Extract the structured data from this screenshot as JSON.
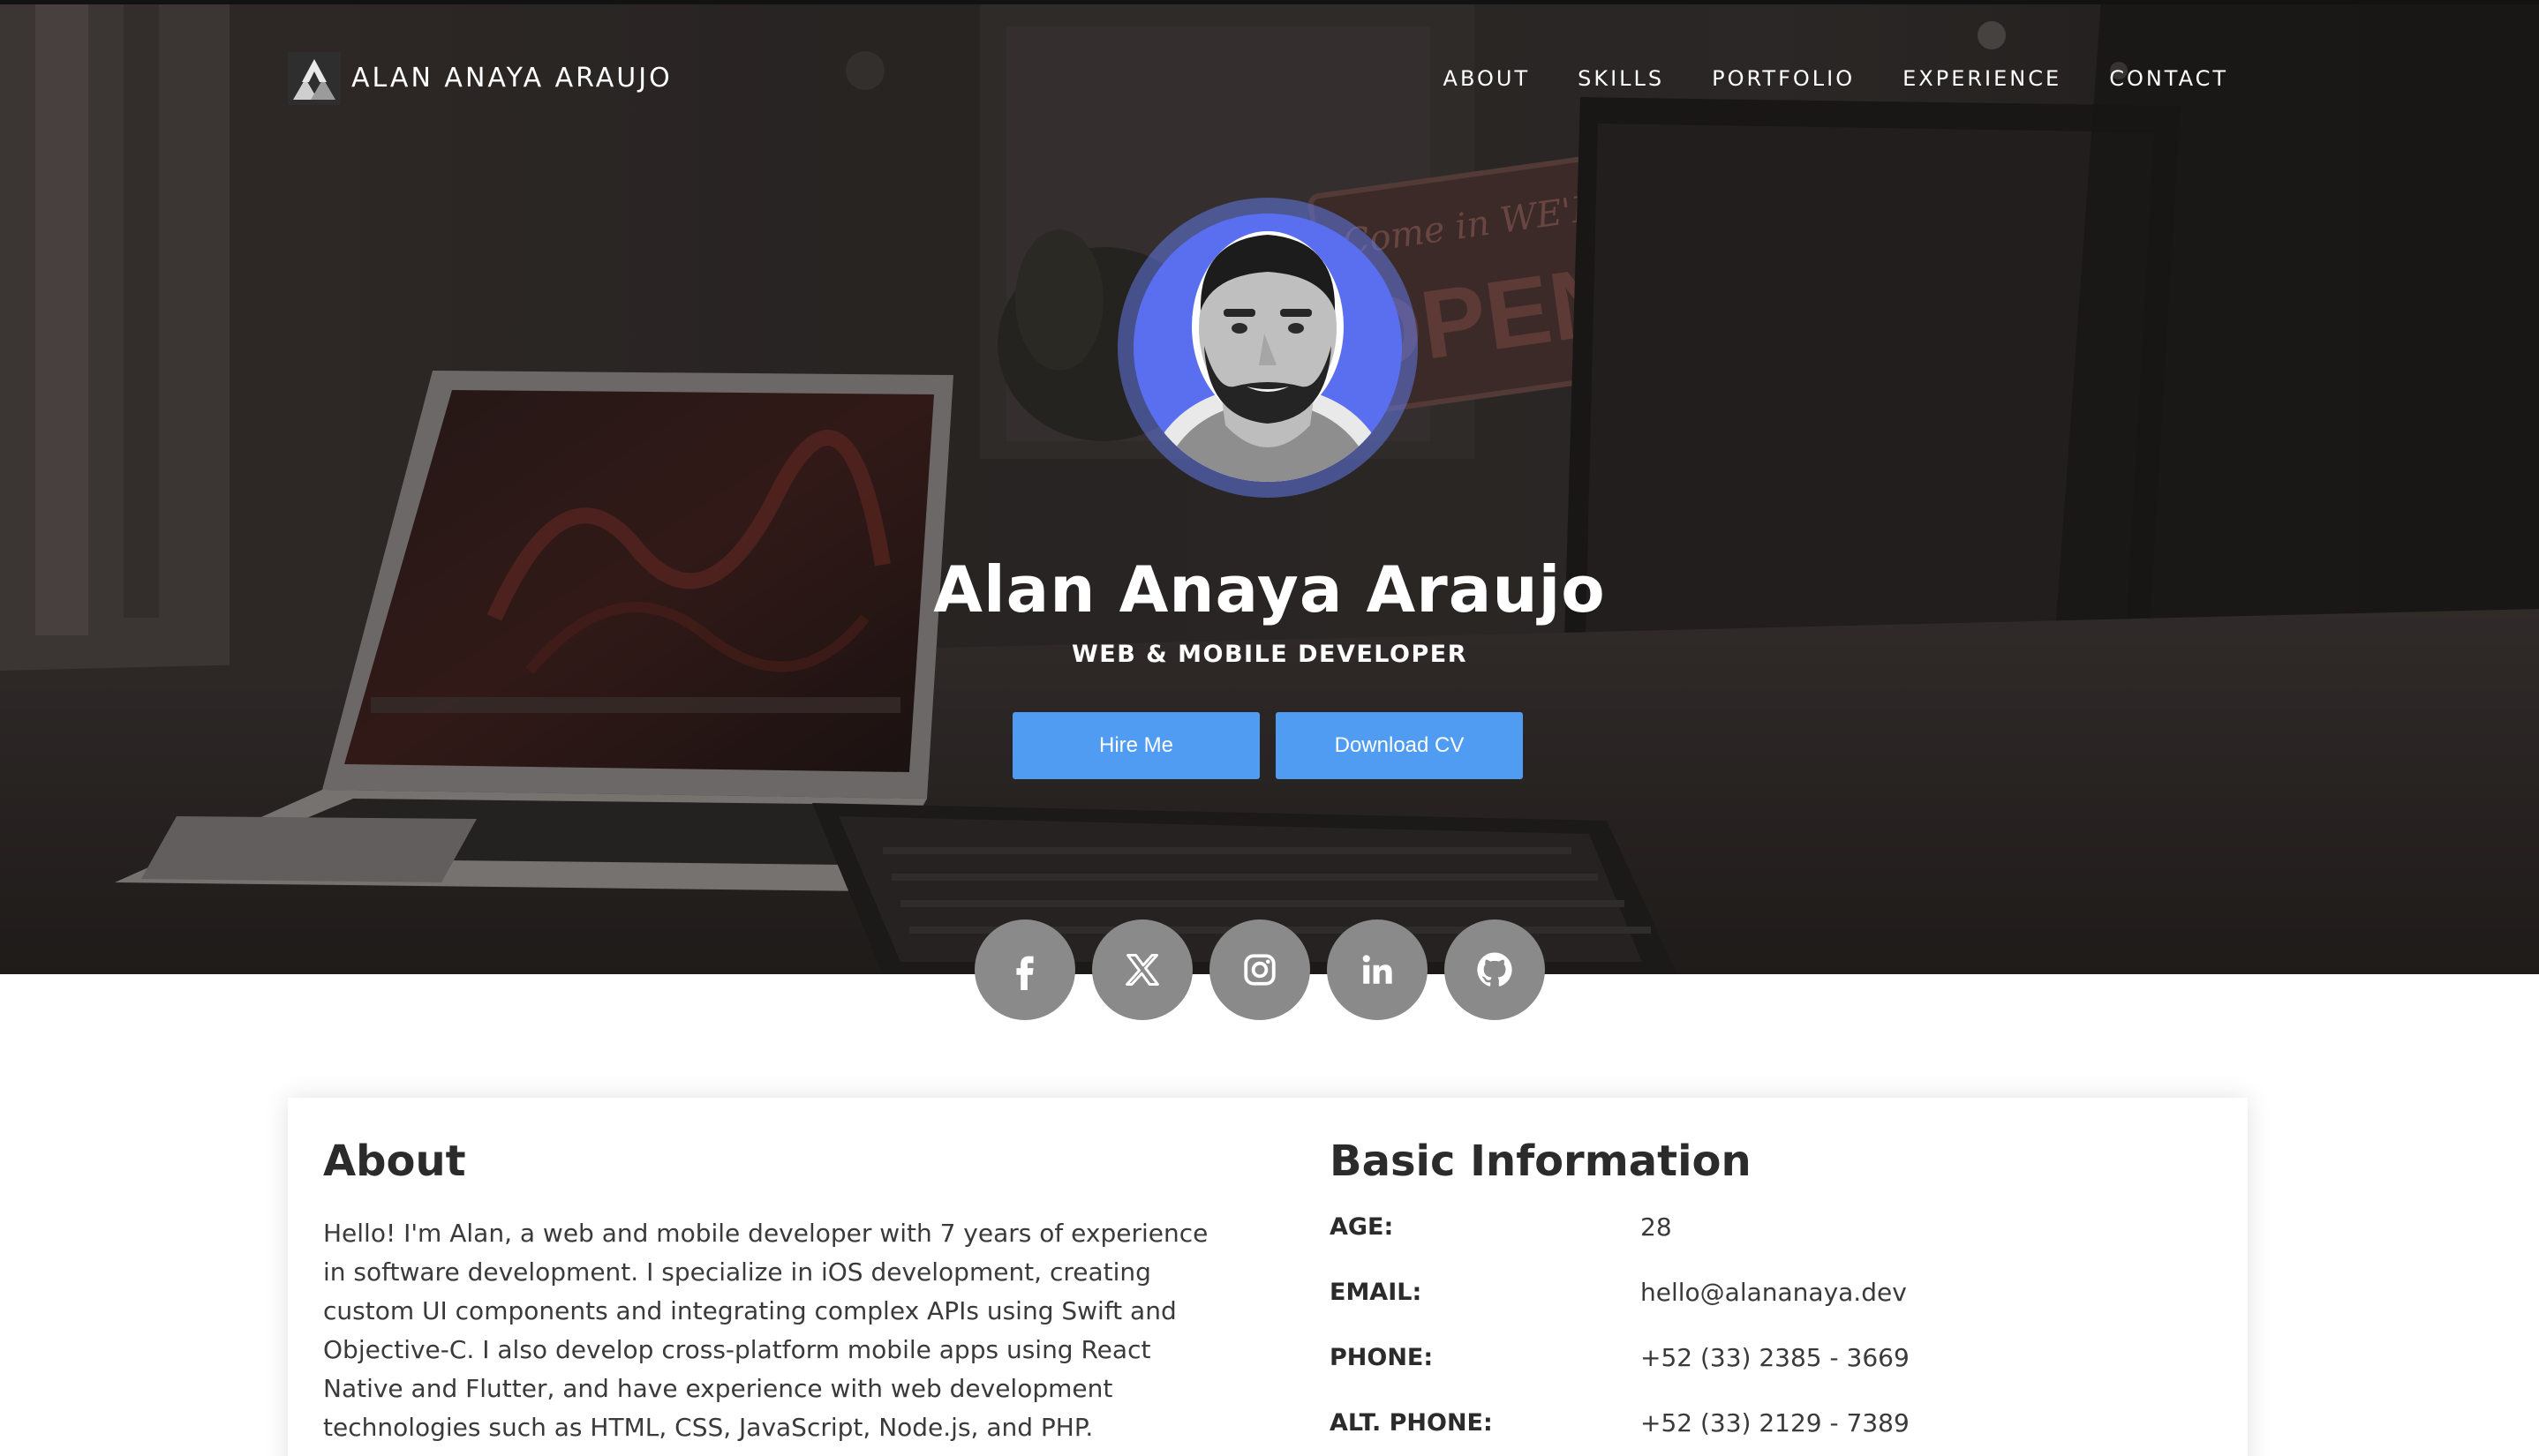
{
  "brand": {
    "name": "ALAN ANAYA ARAUJO",
    "logo_icon": "triangles-logo-icon"
  },
  "nav": {
    "items": [
      {
        "label": "ABOUT"
      },
      {
        "label": "SKILLS"
      },
      {
        "label": "PORTFOLIO"
      },
      {
        "label": "EXPERIENCE"
      },
      {
        "label": "CONTACT"
      }
    ]
  },
  "hero": {
    "name": "Alan Anaya Araujo",
    "role": "WEB & MOBILE DEVELOPER",
    "hire_label": "Hire Me",
    "cv_label": "Download CV",
    "background_sign_text": [
      "Come in WE'RE",
      "OPEN"
    ]
  },
  "social": [
    {
      "icon": "facebook-icon"
    },
    {
      "icon": "x-icon"
    },
    {
      "icon": "instagram-icon"
    },
    {
      "icon": "linkedin-icon"
    },
    {
      "icon": "github-icon"
    }
  ],
  "about": {
    "title": "About",
    "lines": [
      "Hello! I'm Alan, a web and mobile developer with 7 years of experience",
      "in software development. I specialize in iOS development, creating",
      "custom UI components and integrating complex APIs using Swift and",
      "Objective-C. I also develop cross-platform mobile apps using React",
      "Native and Flutter, and have experience with web development",
      "technologies such as HTML, CSS, JavaScript, Node.js, and PHP."
    ]
  },
  "basic_info": {
    "title": "Basic Information",
    "rows": [
      {
        "label": "AGE:",
        "value": "28"
      },
      {
        "label": "EMAIL:",
        "value": "hello@alananaya.dev"
      },
      {
        "label": "PHONE:",
        "value": "+52 (33) 2385 - 3669"
      },
      {
        "label": "ALT. PHONE:",
        "value": "+52 (33) 2129 - 7389"
      }
    ]
  },
  "colors": {
    "accent": "#4f9cf2",
    "avatar_bg": "#5a6ff0",
    "social_bg": "#8a8a8a",
    "text_dark": "#2b2b2b"
  }
}
